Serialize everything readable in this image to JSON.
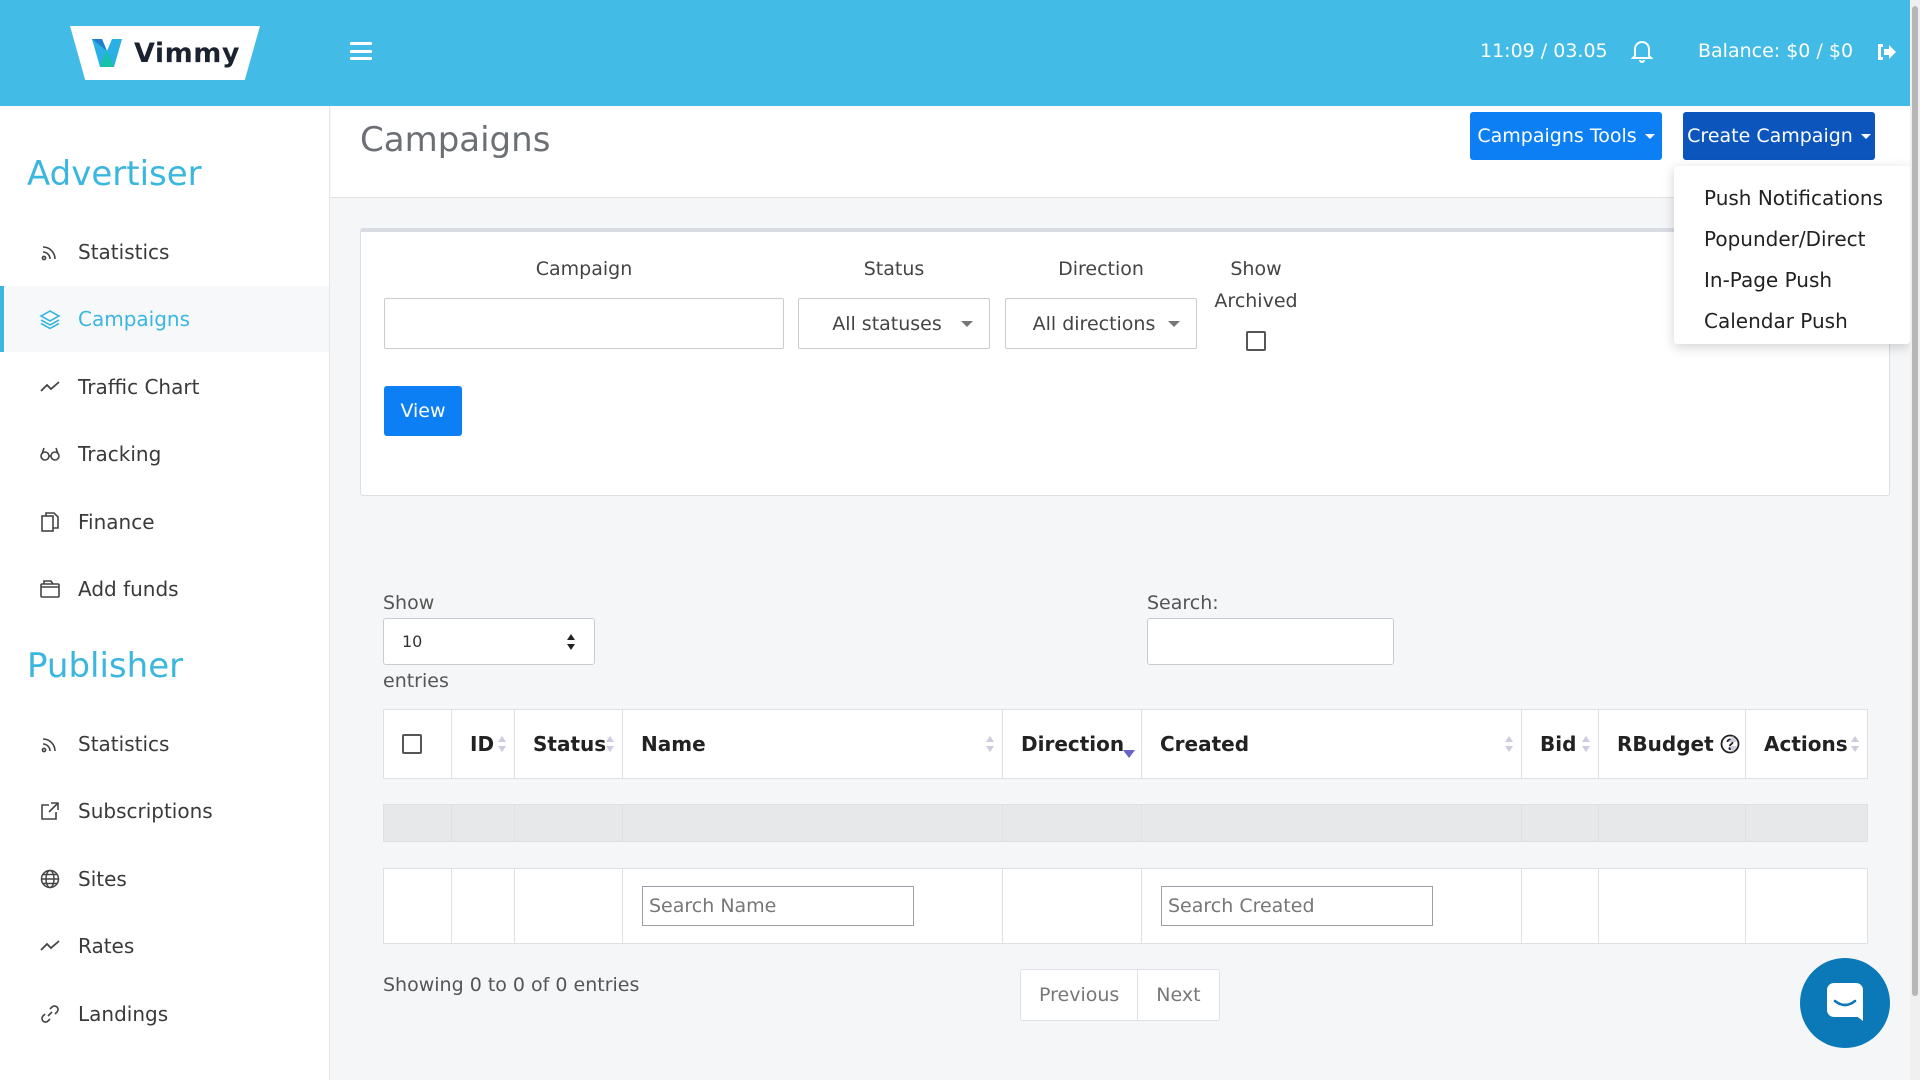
{
  "header": {
    "brand": "Vimmy",
    "time": "11:09 / 03.05",
    "balance": "Balance: $0 / $0"
  },
  "sidebar": {
    "advertiser_title": "Advertiser",
    "advertiser_items": [
      {
        "label": "Statistics",
        "icon": "rss-icon"
      },
      {
        "label": "Campaigns",
        "icon": "layers-icon"
      },
      {
        "label": "Traffic Chart",
        "icon": "trend-line-icon"
      },
      {
        "label": "Tracking",
        "icon": "glasses-icon"
      },
      {
        "label": "Finance",
        "icon": "documents-icon"
      },
      {
        "label": "Add funds",
        "icon": "wallet-icon"
      }
    ],
    "publisher_title": "Publisher",
    "publisher_items": [
      {
        "label": "Statistics",
        "icon": "rss-icon"
      },
      {
        "label": "Subscriptions",
        "icon": "external-square-icon"
      },
      {
        "label": "Sites",
        "icon": "globe-icon"
      },
      {
        "label": "Rates",
        "icon": "trend-line-icon"
      },
      {
        "label": "Landings",
        "icon": "link-icon"
      }
    ],
    "active_item": "Campaigns"
  },
  "page": {
    "title": "Campaigns",
    "tools_button": "Campaigns Tools",
    "create_button": "Create Campaign",
    "create_menu": [
      "Push Notifications",
      "Popunder/Direct",
      "In-Page Push",
      "Calendar Push"
    ]
  },
  "filters": {
    "campaign_label": "Campaign",
    "campaign_value": "",
    "status_label": "Status",
    "status_value": "All statuses",
    "direction_label": "Direction",
    "direction_value": "All directions",
    "archived_label_1": "Show",
    "archived_label_2": "Archived",
    "archived_checked": false,
    "view_button": "View"
  },
  "table": {
    "show_label": "Show",
    "page_length": "10",
    "entries_label": "entries",
    "search_label": "Search:",
    "search_value": "",
    "columns": [
      "ID",
      "Status",
      "Name",
      "Direction",
      "Created",
      "Bid",
      "RBudget",
      "Actions"
    ],
    "sorted_column": "Direction",
    "search_name_placeholder": "Search Name",
    "search_created_placeholder": "Search Created",
    "info": "Showing 0 to 0 of 0 entries",
    "prev": "Previous",
    "next": "Next"
  },
  "colors": {
    "header": "#42bce6",
    "accent": "#3bb6de",
    "primary_button": "#0d7ff5",
    "create_button": "#0b55bd"
  }
}
